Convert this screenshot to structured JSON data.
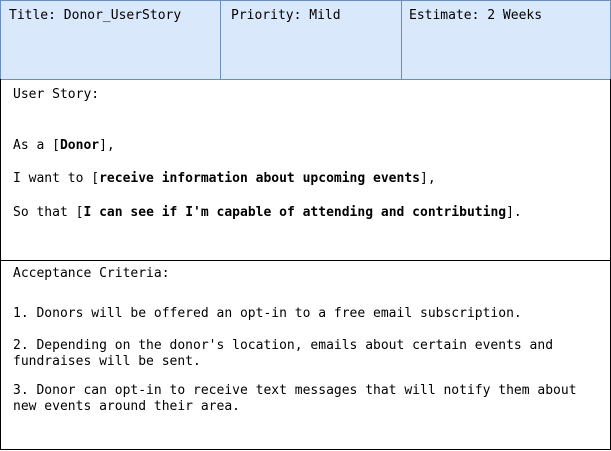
{
  "header": {
    "title": "Title: Donor_UserStory",
    "priority": "Priority: Mild",
    "estimate": "Estimate: 2 Weeks"
  },
  "story": {
    "heading": "User Story:",
    "line1_prefix": "As a [",
    "line1_bold": "Donor",
    "line1_suffix": "],",
    "line2_prefix": "I want to [",
    "line2_bold": "receive information about upcoming events",
    "line2_suffix": "],",
    "line3_prefix": "So that [",
    "line3_bold": "I can see if I'm capable of attending and contributing",
    "line3_suffix": "]."
  },
  "criteria": {
    "heading": "Acceptance Criteria:",
    "items": [
      "1. Donors will be offered an opt-in to a free email subscription.",
      "2. Depending on the donor's location, emails about certain events and fundraises will be sent.",
      "3. Donor can opt-in to receive text messages that will notify them about new events around their area."
    ]
  },
  "colors": {
    "header_fill": "#dae8fc",
    "header_border": "#6c8ebf"
  }
}
